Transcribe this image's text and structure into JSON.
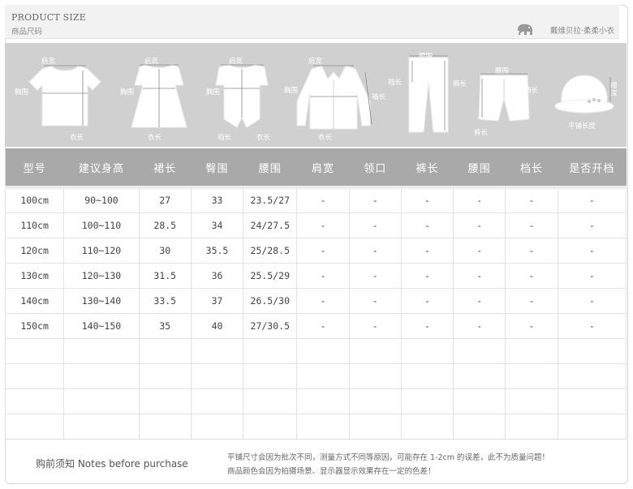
{
  "header": {
    "title_en": "PRODUCT SIZE",
    "title_cn": "商品尺码",
    "brand": "戴维贝拉·柔柔小衣",
    "brand_icon": "elephant-icon"
  },
  "garments": {
    "tee": {
      "shoulder": "肩宽",
      "chest": "胸围",
      "length": "衣长"
    },
    "dress": {
      "shoulder": "肩宽",
      "chest": "胸围",
      "length": "衣长"
    },
    "romper": {
      "shoulder": "肩宽",
      "chest": "胸围",
      "crotch": "裆长",
      "length": "衣长"
    },
    "shirt": {
      "shoulder": "肩宽",
      "chest": "胸围",
      "sleeve": "袖长",
      "length": "衣长"
    },
    "pants": {
      "waist": "腰围",
      "rise": "裆长",
      "length": "裤长"
    },
    "shorts": {
      "waist": "腰围",
      "rise": "裆长",
      "length": "裤长"
    },
    "hat": {
      "height": "帽深",
      "width": "平铺长度"
    }
  },
  "table": {
    "headers": [
      "型号",
      "建议身高",
      "裙长",
      "臀围",
      "腰围",
      "肩宽",
      "领口",
      "裤长",
      "腰围",
      "档长",
      "是否开档"
    ],
    "rows": [
      [
        "100cm",
        "90~100",
        "27",
        "33",
        "23.5/27",
        "-",
        "-",
        "-",
        "-",
        "-",
        "-"
      ],
      [
        "110cm",
        "100~110",
        "28.5",
        "34",
        "24/27.5",
        "-",
        "-",
        "-",
        "-",
        "-",
        "-"
      ],
      [
        "120cm",
        "110~120",
        "30",
        "35.5",
        "25/28.5",
        "-",
        "-",
        "-",
        "-",
        "-",
        "-"
      ],
      [
        "130cm",
        "120~130",
        "31.5",
        "36",
        "25.5/29",
        "-",
        "-",
        "-",
        "-",
        "-",
        "-"
      ],
      [
        "140cm",
        "130~140",
        "33.5",
        "37",
        "26.5/30",
        "-",
        "-",
        "-",
        "-",
        "-",
        "-"
      ],
      [
        "150cm",
        "140~150",
        "35",
        "40",
        "27/30.5",
        "-",
        "-",
        "-",
        "-",
        "-",
        "-"
      ]
    ],
    "empty_rows": 4
  },
  "footer": {
    "notes_title": "购前须知 Notes before purchase",
    "line1": "平铺尺寸会因为批次不同，测量方式不同等原因，可能存在 1-2cm 的误差，此不为质量问题！",
    "line2": "商品颜色会因为拍摄场景、显示器显示效果存在一定的色差！"
  }
}
